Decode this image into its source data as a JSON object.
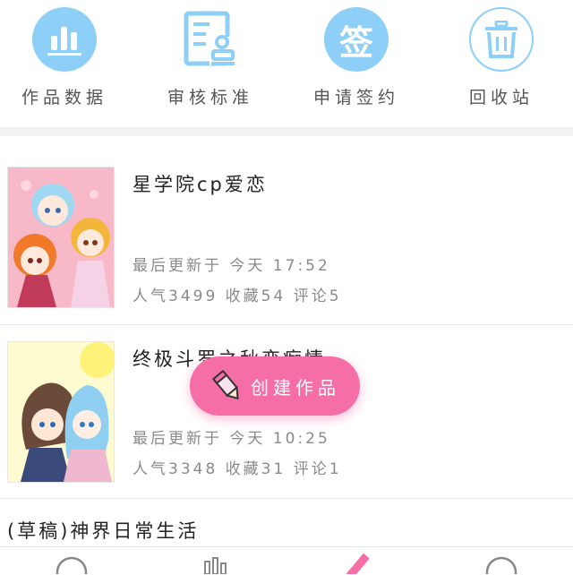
{
  "actions": [
    {
      "label": "作品数据",
      "icon": "bar-chart-icon"
    },
    {
      "label": "审核标准",
      "icon": "document-review-icon"
    },
    {
      "label": "申请签约",
      "icon": "sign-contract-icon",
      "glyph": "签"
    },
    {
      "label": "回收站",
      "icon": "trash-icon"
    }
  ],
  "works": [
    {
      "title": "星学院cp爱恋",
      "updated": "最后更新于 今天 17:52",
      "stats": "人气3499 收藏54 评论5"
    },
    {
      "title": "终极斗罗之秋恋痴情",
      "updated": "最后更新于 今天 10:25",
      "stats": "人气3348 收藏31 评论1"
    },
    {
      "title": "(草稿)神界日常生活"
    }
  ],
  "fab": {
    "label": "创建作品"
  },
  "tabs": [
    {
      "icon": "home-icon"
    },
    {
      "icon": "stats-icon"
    },
    {
      "icon": "pen-icon"
    },
    {
      "icon": "profile-icon"
    }
  ],
  "colors": {
    "accent_blue": "#8ecff7",
    "accent_pink": "#f56fa6"
  }
}
